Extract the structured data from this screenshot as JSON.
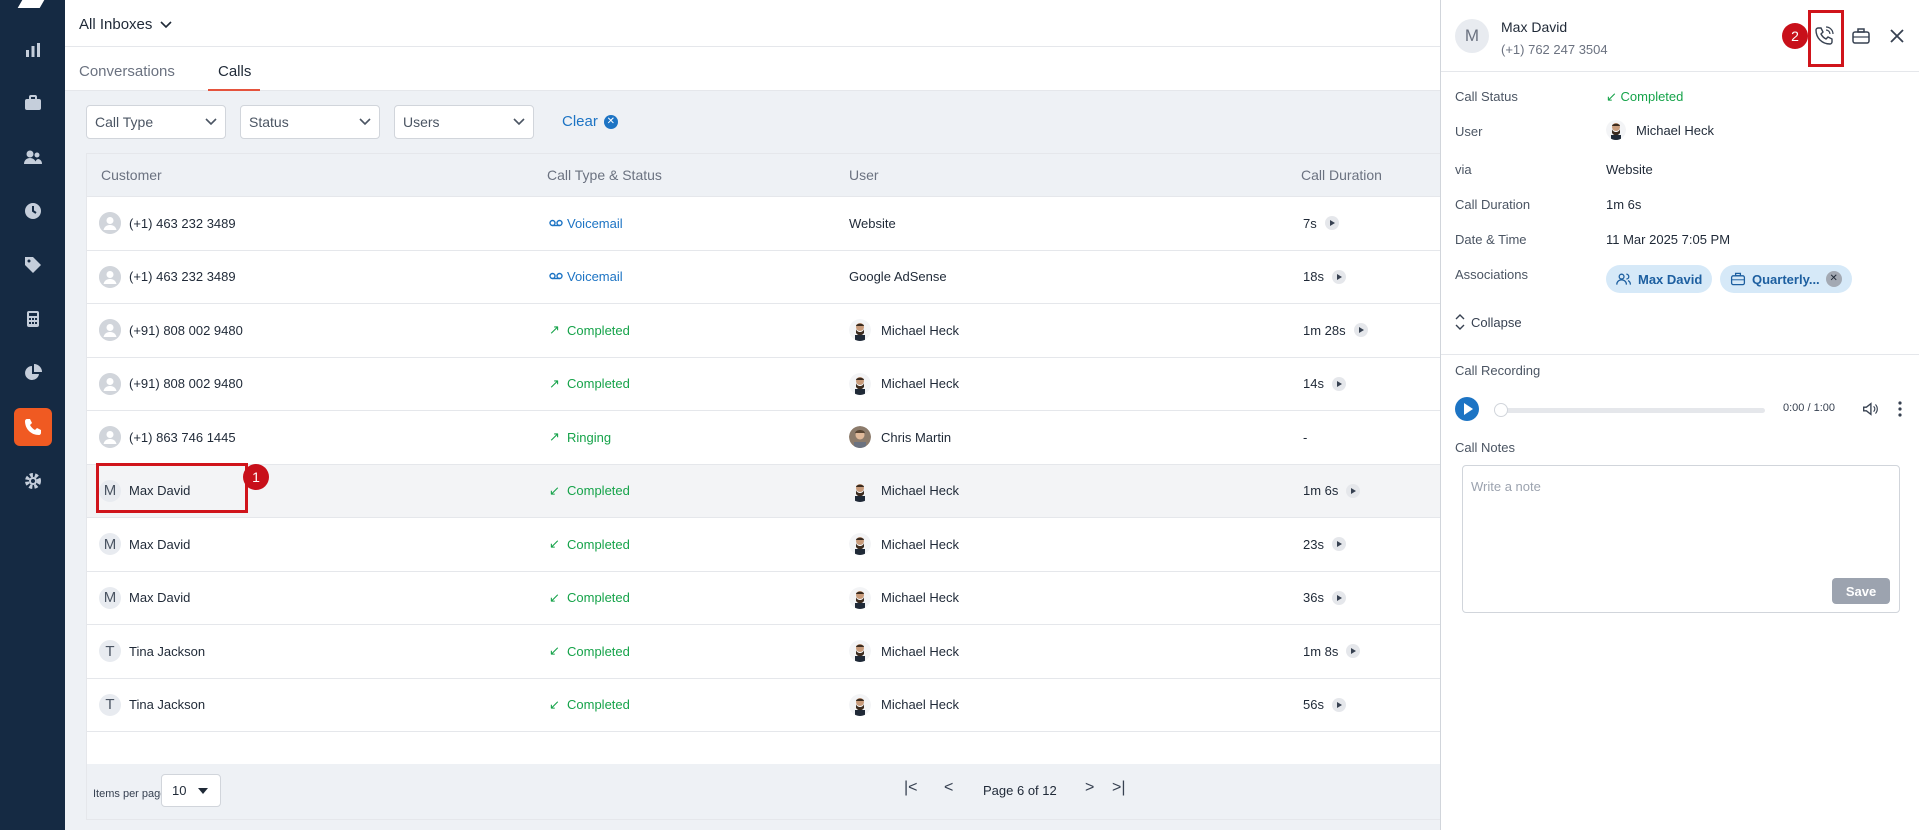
{
  "header": {
    "inbox": "All Inboxes"
  },
  "tabs": [
    {
      "label": "Conversations"
    },
    {
      "label": "Calls"
    }
  ],
  "filters": {
    "call_type": "Call Type",
    "status": "Status",
    "users": "Users",
    "clear": "Clear"
  },
  "table": {
    "columns": [
      "Customer",
      "Call Type & Status",
      "User",
      "Call Duration"
    ],
    "rows": [
      {
        "customer": "(+1) 463 232 3489",
        "avatar": "",
        "status": "Voicemail",
        "status_kind": "voicemail",
        "user": "Website",
        "duration": "7s"
      },
      {
        "customer": "(+1) 463 232 3489",
        "avatar": "",
        "status": "Voicemail",
        "status_kind": "voicemail",
        "user": "Google AdSense",
        "duration": "18s"
      },
      {
        "customer": "(+91) 808 002 9480",
        "avatar": "",
        "status": "Completed",
        "status_kind": "outgoing",
        "user": "Michael Heck",
        "duration": "1m 28s"
      },
      {
        "customer": "(+91) 808 002 9480",
        "avatar": "",
        "status": "Completed",
        "status_kind": "outgoing",
        "user": "Michael Heck",
        "duration": "14s"
      },
      {
        "customer": "(+1) 863 746 1445",
        "avatar": "",
        "status": "Ringing",
        "status_kind": "outgoing",
        "user": "Chris Martin",
        "duration": "-"
      },
      {
        "customer": "Max David",
        "avatar": "M",
        "status": "Completed",
        "status_kind": "incoming",
        "user": "Michael Heck",
        "duration": "1m 6s"
      },
      {
        "customer": "Max David",
        "avatar": "M",
        "status": "Completed",
        "status_kind": "incoming",
        "user": "Michael Heck",
        "duration": "23s"
      },
      {
        "customer": "Max David",
        "avatar": "M",
        "status": "Completed",
        "status_kind": "incoming",
        "user": "Michael Heck",
        "duration": "36s"
      },
      {
        "customer": "Tina Jackson",
        "avatar": "T",
        "status": "Completed",
        "status_kind": "incoming",
        "user": "Michael Heck",
        "duration": "1m 8s"
      },
      {
        "customer": "Tina Jackson",
        "avatar": "T",
        "status": "Completed",
        "status_kind": "incoming",
        "user": "Michael Heck",
        "duration": "56s"
      }
    ]
  },
  "pagination": {
    "items_per_page_label": "Items per page",
    "items_per_page": "10",
    "page_text": "Page 6 of 12"
  },
  "annotations": {
    "badge1": "1",
    "badge2": "2"
  },
  "panel": {
    "avatar": "M",
    "name": "Max David",
    "phone": "(+1) 762 247 3504",
    "details": {
      "call_status_label": "Call Status",
      "call_status": "Completed",
      "user_label": "User",
      "user": "Michael Heck",
      "via_label": "via",
      "via": "Website",
      "duration_label": "Call Duration",
      "duration": "1m 6s",
      "datetime_label": "Date & Time",
      "datetime": "11 Mar 2025 7:05 PM",
      "associations_label": "Associations",
      "assoc_contact": "Max David",
      "assoc_deal": "Quarterly...",
      "collapse": "Collapse"
    },
    "recording": {
      "label": "Call Recording",
      "time": "0:00 / 1:00"
    },
    "notes": {
      "label": "Call Notes",
      "placeholder": "Write a note",
      "save": "Save"
    }
  },
  "colors": {
    "sidebar": "#152a43",
    "accent": "#f05a22",
    "link": "#1d74c4",
    "success": "#16a34a",
    "annotation": "#d0141b"
  }
}
